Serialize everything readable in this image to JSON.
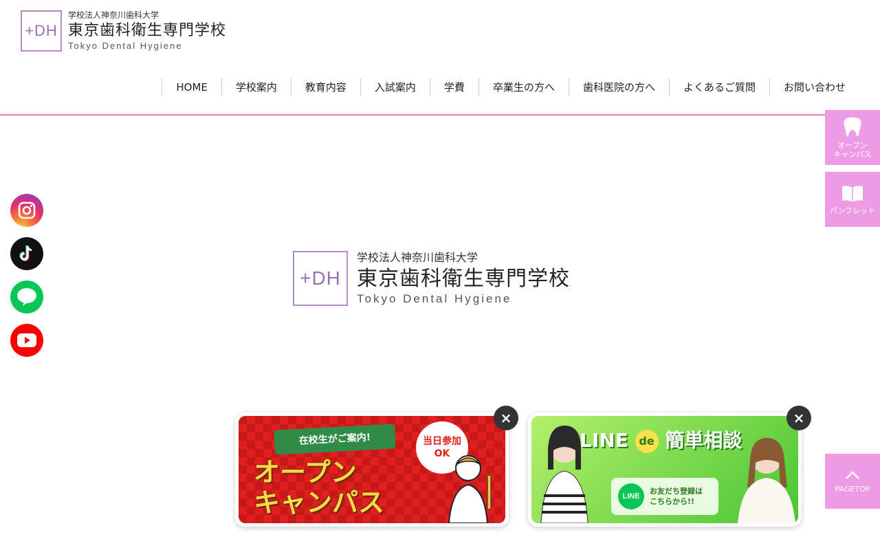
{
  "header": {
    "logo_mark": "+DH",
    "logo_sub": "学校法人神奈川歯科大学",
    "logo_main": "東京歯科衛生専門学校",
    "logo_en": "Tokyo Dental Hygiene"
  },
  "nav": {
    "items": [
      {
        "label": "HOME"
      },
      {
        "label": "学校案内"
      },
      {
        "label": "教育内容"
      },
      {
        "label": "入試案内"
      },
      {
        "label": "学費"
      },
      {
        "label": "卒業生の方へ"
      },
      {
        "label": "歯科医院の方へ"
      },
      {
        "label": "よくあるご質問"
      },
      {
        "label": "お問い合わせ"
      }
    ]
  },
  "hero": {
    "logo_mark": "+DH",
    "logo_sub": "学校法人神奈川歯科大学",
    "logo_main": "東京歯科衛生専門学校",
    "logo_en": "Tokyo Dental Hygiene"
  },
  "social": {
    "line_label": "LINE"
  },
  "side_tabs": {
    "open_campus_line1": "オープン",
    "open_campus_line2": "キャンパス",
    "pamphlet": "パンフレット",
    "pagetop": "PAGETOP"
  },
  "banners": {
    "close_glyph": "×",
    "oc_ribbon": "在校生がご案内!",
    "oc_title_line1": "オープン",
    "oc_title_line2": "キャンパス",
    "oc_badge_line1": "当日参加",
    "oc_badge_line2": "OK",
    "line_title_a": "LINE",
    "line_title_de": "de",
    "line_title_b": "簡単相談",
    "line_bubble": "LINE",
    "line_box_line1": "お友だち登録は",
    "line_box_line2": "こちらから!!"
  },
  "colors": {
    "accent_pink": "#e07bb6",
    "side_tab": "#ee9be6",
    "logo_purple": "#9b6fb0"
  }
}
